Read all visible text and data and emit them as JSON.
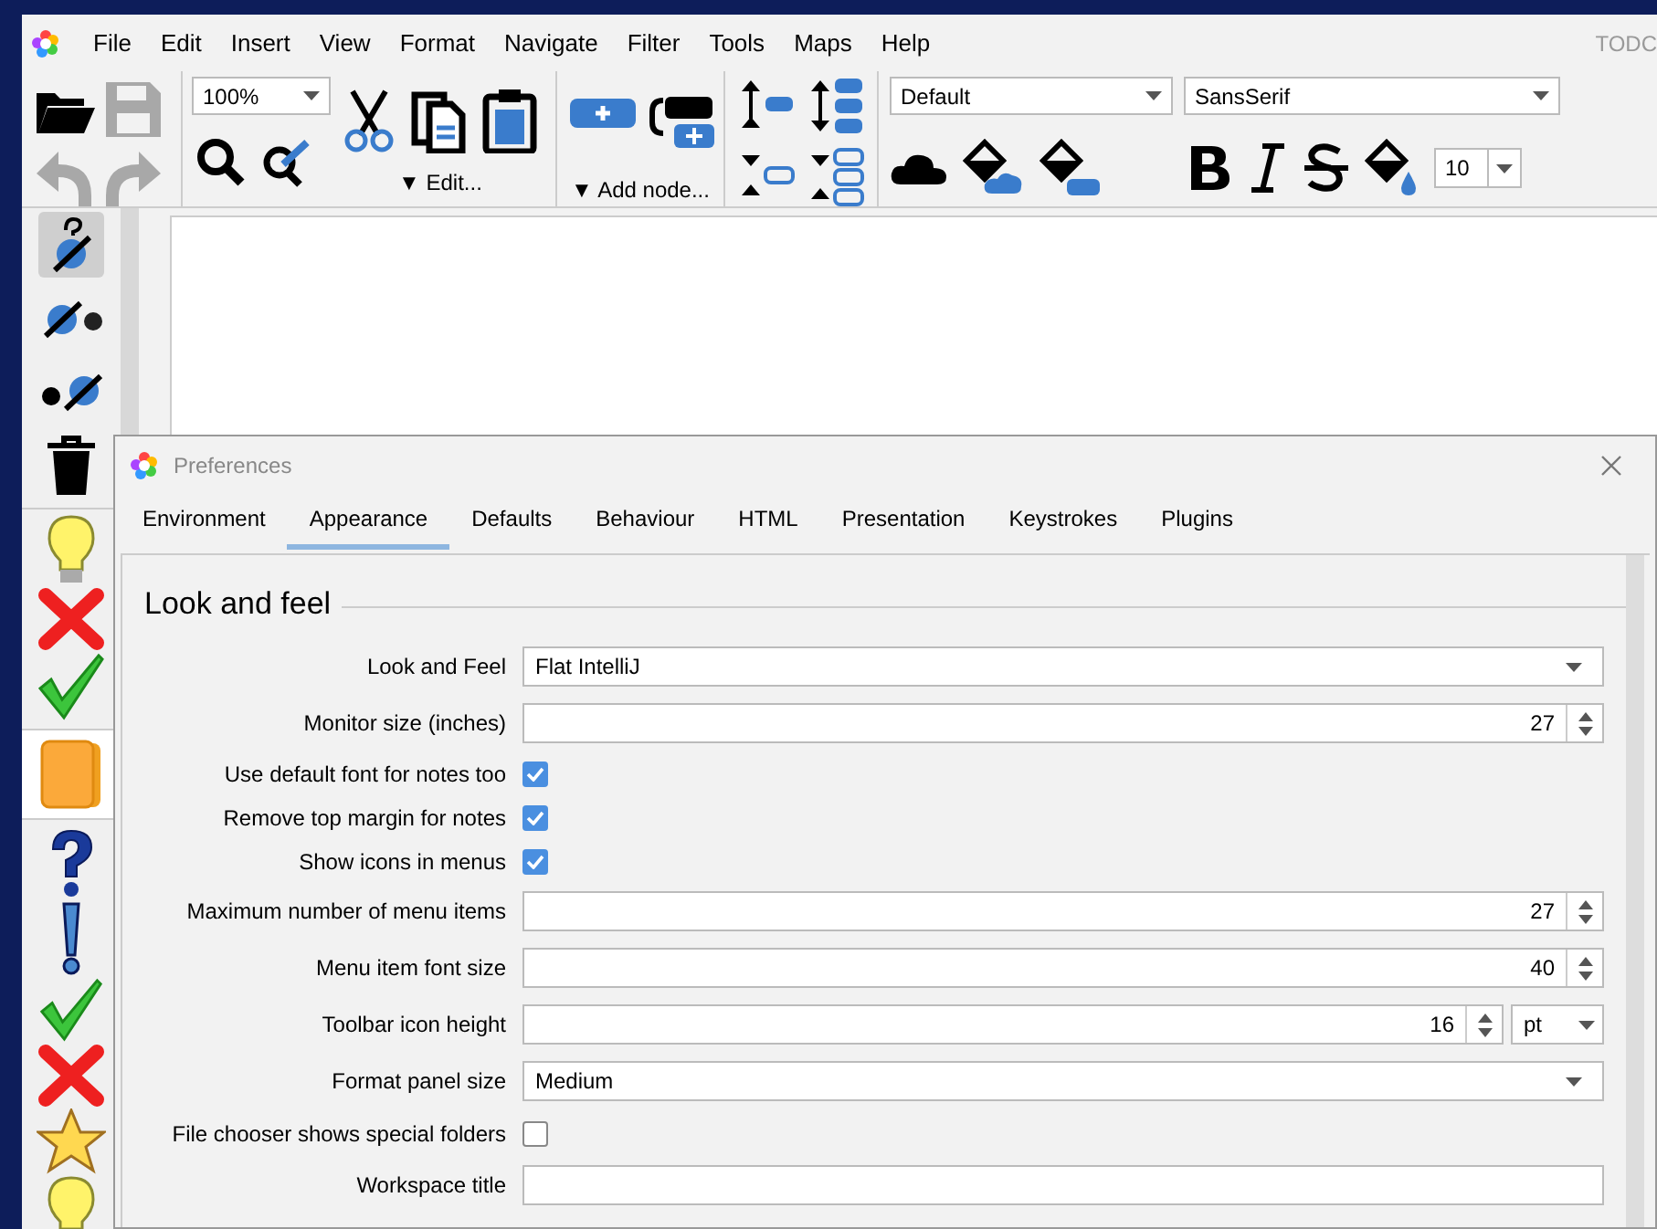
{
  "menu": [
    "File",
    "Edit",
    "Insert",
    "View",
    "Format",
    "Navigate",
    "Filter",
    "Tools",
    "Maps",
    "Help"
  ],
  "window_title": "TODC",
  "toolbar": {
    "file_buttons": [
      {
        "kind": "open",
        "disabled": false
      },
      {
        "kind": "save",
        "disabled": true
      },
      {
        "kind": "undo",
        "disabled": true
      },
      {
        "kind": "redo",
        "disabled": true
      }
    ],
    "zoom": "100%",
    "edit_menu": "▼ Edit...",
    "add_node_menu": "▼ Add node...",
    "style": "Default",
    "font": "SansSerif",
    "font_size": "10"
  },
  "side_tools": [
    {
      "kind": "link-help",
      "selected": true
    },
    {
      "kind": "link-out",
      "selected": false
    },
    {
      "kind": "link-in",
      "selected": false
    },
    {
      "kind": "delete",
      "selected": false
    }
  ],
  "dialog": {
    "title": "Preferences",
    "tabs": [
      {
        "label": "Environment",
        "selected": false
      },
      {
        "label": "Appearance",
        "selected": true
      },
      {
        "label": "Defaults",
        "selected": false
      },
      {
        "label": "Behaviour",
        "selected": false
      },
      {
        "label": "HTML",
        "selected": false
      },
      {
        "label": "Presentation",
        "selected": false
      },
      {
        "label": "Keystrokes",
        "selected": false
      },
      {
        "label": "Plugins",
        "selected": false
      }
    ],
    "section": "Look and feel",
    "rows": [
      {
        "kind": "dropdown",
        "label": "Look and Feel",
        "value": "Flat IntelliJ"
      },
      {
        "kind": "spinner",
        "label": "Monitor size (inches)",
        "value": "27"
      },
      {
        "kind": "checkbox",
        "label": "Use default font for notes too",
        "checked": true
      },
      {
        "kind": "checkbox",
        "label": "Remove top margin for notes",
        "checked": true
      },
      {
        "kind": "checkbox",
        "label": "Show icons in menus",
        "checked": true
      },
      {
        "kind": "spinner",
        "label": "Maximum number of menu items",
        "value": "27"
      },
      {
        "kind": "spinner",
        "label": "Menu item font size",
        "value": "40"
      },
      {
        "kind": "spinner_unit",
        "label": "Toolbar icon height",
        "value": "16",
        "unit": "pt"
      },
      {
        "kind": "dropdown",
        "label": "Format panel size",
        "value": "Medium"
      },
      {
        "kind": "checkbox",
        "label": "File chooser shows special folders",
        "checked": false
      },
      {
        "kind": "text",
        "label": "Workspace title",
        "value": ""
      }
    ]
  }
}
